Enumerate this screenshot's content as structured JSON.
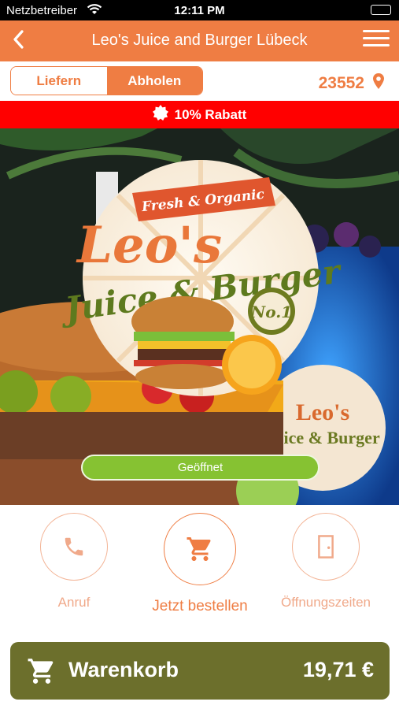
{
  "status_bar": {
    "carrier": "Netzbetreiber",
    "time": "12:11 PM"
  },
  "nav": {
    "title": "Leo's Juice and Burger Lübeck",
    "back_icon": "chevron-left-icon",
    "menu_icon": "hamburger-menu-icon"
  },
  "order_mode": {
    "options": [
      "Liefern",
      "Abholen"
    ],
    "selected": "Abholen"
  },
  "location": {
    "postcode": "23552",
    "icon": "map-pin-icon"
  },
  "discount": {
    "label": "10% Rabatt",
    "icon": "badge-icon"
  },
  "hero": {
    "logo": {
      "tagline": "Fresh & Organic",
      "name_line1": "Leo's",
      "name_line2": "Juice & Burger",
      "badge": "No.1"
    },
    "status_button": "Geöffnet"
  },
  "actions": [
    {
      "label": "Anruf",
      "icon": "phone-icon"
    },
    {
      "label": "Jetzt bestellen",
      "icon": "shopping-cart-icon"
    },
    {
      "label": "Öffnungszeiten",
      "icon": "door-icon"
    }
  ],
  "cart": {
    "label": "Warenkorb",
    "total": "19,71 €",
    "icon": "shopping-cart-icon"
  },
  "colors": {
    "primary": "#ef7d43",
    "discount": "#ff0000",
    "open": "#86c232",
    "cart": "#6c6f2c"
  }
}
